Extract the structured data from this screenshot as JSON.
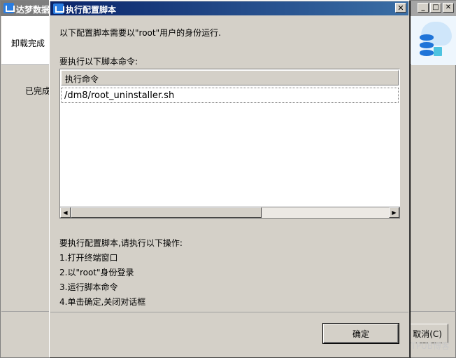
{
  "background_window": {
    "title": "达梦数据",
    "header_text": "卸载完成",
    "body_text": "已完成",
    "cancel_label": "取消(C)"
  },
  "dialog": {
    "title": "执行配置脚本",
    "intro": "以下配置脚本需要以\"root\"用户的身份运行.",
    "commands_label": "要执行以下脚本命令:",
    "table": {
      "columns": [
        "执行命令"
      ],
      "rows": [
        "/dm8/root_uninstaller.sh"
      ]
    },
    "instructions": [
      "要执行配置脚本,请执行以下操作:",
      "1.打开终端窗口",
      "2.以\"root\"身份登录",
      "3.运行脚本命令",
      "4.单击确定,关闭对话框"
    ],
    "ok_label": "确定"
  },
  "watermark": "@ITPUB博客",
  "icons": {
    "app": "dm-app-icon",
    "close": "close-icon",
    "minimize": "minimize-icon",
    "maximize": "maximize-icon",
    "scroll_left": "arrow-left-icon",
    "scroll_right": "arrow-right-icon",
    "logo": "database-cloud-icon"
  },
  "colors": {
    "active_title": "#0a246a",
    "inactive_title": "#808080",
    "face": "#d4d0c8",
    "accent_blue": "#1f74d8"
  }
}
